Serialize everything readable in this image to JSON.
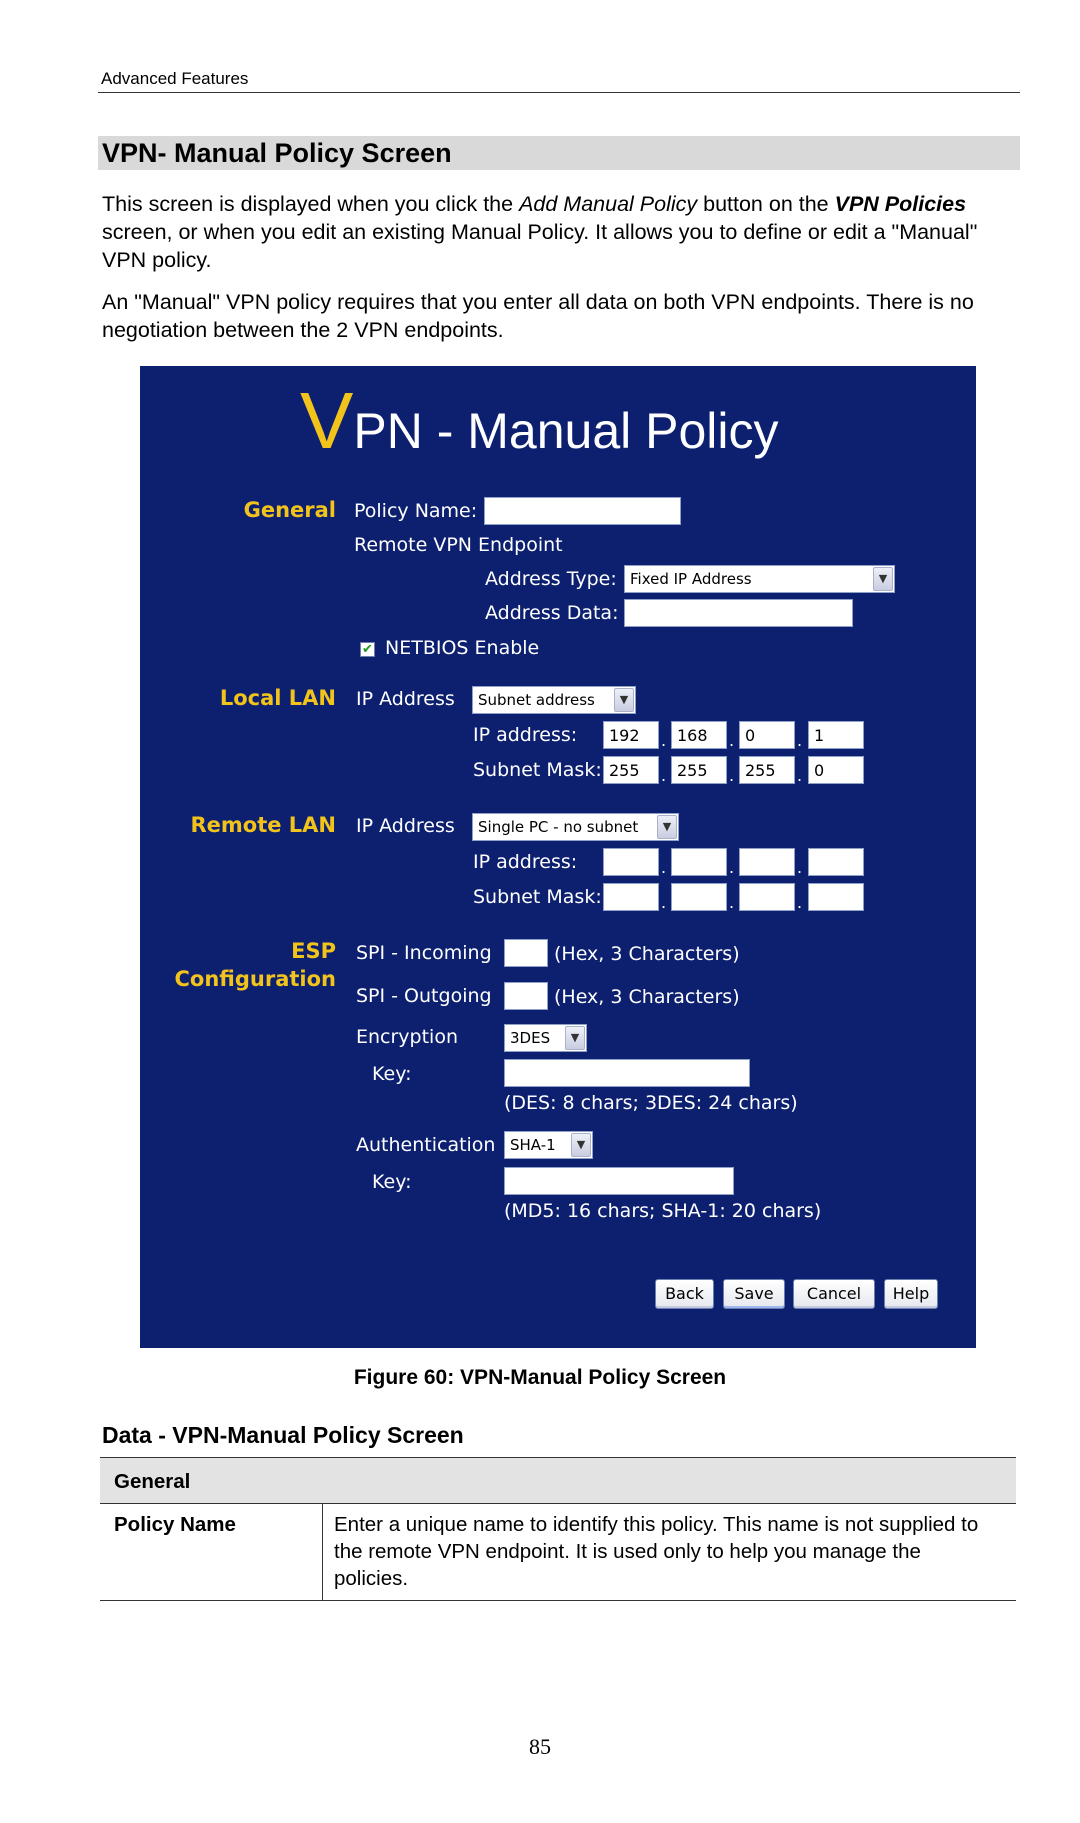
{
  "running_header": "Advanced Features",
  "section_title": "VPN- Manual Policy Screen",
  "intro": {
    "p1_before_italic": "This screen is displayed when you click the ",
    "p1_italic": "Add Manual Policy",
    "p1_middle": " button on the ",
    "p1_bold_italic": "VPN Policies",
    "p1_after": " screen, or when you edit an existing Manual Policy. It allows you to define or edit a \"Manual\" VPN policy.",
    "p2": "An \"Manual\" VPN policy requires that you enter all data on both VPN endpoints. There is no negotiation between the 2 VPN endpoints."
  },
  "figure": {
    "title_first_letter": "V",
    "title_rest": "PN - Manual Policy",
    "colors": {
      "panel_bg": "#0d2070",
      "accent": "#f2c31b",
      "label": "#ffffff"
    },
    "general": {
      "section_label": "General",
      "policy_name_label": "Policy Name:",
      "policy_name_value": "",
      "remote_endpoint_label": "Remote VPN Endpoint",
      "address_type_label": "Address Type:",
      "address_type_value": "Fixed IP Address",
      "address_data_label": "Address Data:",
      "address_data_value": "",
      "netbios_label": "NETBIOS Enable",
      "netbios_checked": true
    },
    "local_lan": {
      "section_label": "Local LAN",
      "ip_address_label": "IP Address",
      "ip_type_value": "Subnet address",
      "ip_label": "IP address:",
      "ip": [
        "192",
        "168",
        "0",
        "1"
      ],
      "mask_label": "Subnet Mask:",
      "mask": [
        "255",
        "255",
        "255",
        "0"
      ]
    },
    "remote_lan": {
      "section_label": "Remote LAN",
      "ip_address_label": "IP Address",
      "ip_type_value": "Single PC - no subnet",
      "ip_label": "IP address:",
      "ip": [
        "",
        "",
        "",
        ""
      ],
      "mask_label": "Subnet Mask:",
      "mask": [
        "",
        "",
        "",
        ""
      ]
    },
    "esp": {
      "section_label_1": "ESP",
      "section_label_2": "Configuration",
      "spi_in_label": "SPI - Incoming",
      "spi_in_hint": "(Hex, 3 Characters)",
      "spi_out_label": "SPI - Outgoing",
      "spi_out_hint": "(Hex, 3 Characters)",
      "encryption_label": "Encryption",
      "encryption_value": "3DES",
      "enc_key_label": "Key:",
      "enc_key_hint": "(DES: 8 chars;   3DES: 24 chars)",
      "auth_label": "Authentication",
      "auth_value": "SHA-1",
      "auth_key_label": "Key:",
      "auth_key_hint": "(MD5: 16 chars;   SHA-1: 20 chars)"
    },
    "buttons": {
      "back": "Back",
      "save": "Save",
      "cancel": "Cancel",
      "help": "Help"
    },
    "caption": "Figure 60: VPN-Manual Policy Screen"
  },
  "data_section": {
    "title": "Data - VPN-Manual Policy Screen",
    "table": {
      "group_header": "General",
      "rows": [
        {
          "field": "Policy Name",
          "description": "Enter a unique name to identify this policy. This name is not supplied to the remote VPN endpoint. It is used only to help you manage the policies."
        }
      ]
    }
  },
  "page_number": "85"
}
